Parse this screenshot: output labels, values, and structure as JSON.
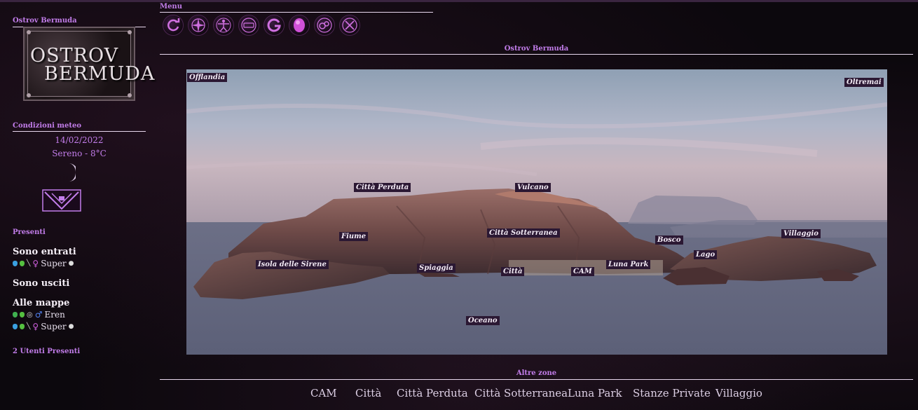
{
  "sidebar": {
    "site_title": "Ostrov Bermuda",
    "logo_line1": "OSTROV",
    "logo_line2": "BERMUDA",
    "weather_title": "Condizioni meteo",
    "weather_date": "14/02/2022",
    "weather_desc": "Sereno - 8°C",
    "present_title": "Presenti",
    "entered_title": "Sono entrati",
    "exited_title": "Sono usciti",
    "maps_title": "Alle mappe",
    "entered_users": [
      {
        "name": "Super",
        "gender_icon": "female-icon"
      }
    ],
    "map_users": [
      {
        "name": "Eren",
        "gender_icon": "male-icon"
      },
      {
        "name": "Super",
        "gender_icon": "female-icon"
      }
    ],
    "users_count": "2 Utenti Presenti"
  },
  "menu": {
    "title": "Menu",
    "icons": [
      "refresh-icon",
      "compass-icon",
      "vitruvian-icon",
      "scroll-icon",
      "swirl-icon",
      "orb-icon",
      "gears-icon",
      "close-icon"
    ]
  },
  "map": {
    "title": "Ostrov Bermuda",
    "labels": {
      "offlandia": "Offlandia",
      "oltremai": "Oltremai",
      "citta_perduta": "Città  Perduta",
      "vulcano": "Vulcano",
      "citta_sotterranea": "Città Sotterranea",
      "fiume": "Fiume",
      "bosco": "Bosco",
      "villaggio": "Villaggio",
      "lago": "Lago",
      "isola_sirene": "Isola delle Sirene",
      "spiaggia": "Spiaggia",
      "citta": "Città",
      "cam": "CAM",
      "luna_park": "Luna Park",
      "oceano": "Oceano"
    }
  },
  "other_zones": {
    "title": "Altre zone",
    "items": [
      "CAM",
      "Città",
      "Città Perduta",
      "Città Sotterranea",
      "Luna Park",
      "Stanze Private",
      "Villaggio"
    ]
  },
  "colors": {
    "accent": "#c27dea",
    "label_bg": "#2b1833"
  }
}
